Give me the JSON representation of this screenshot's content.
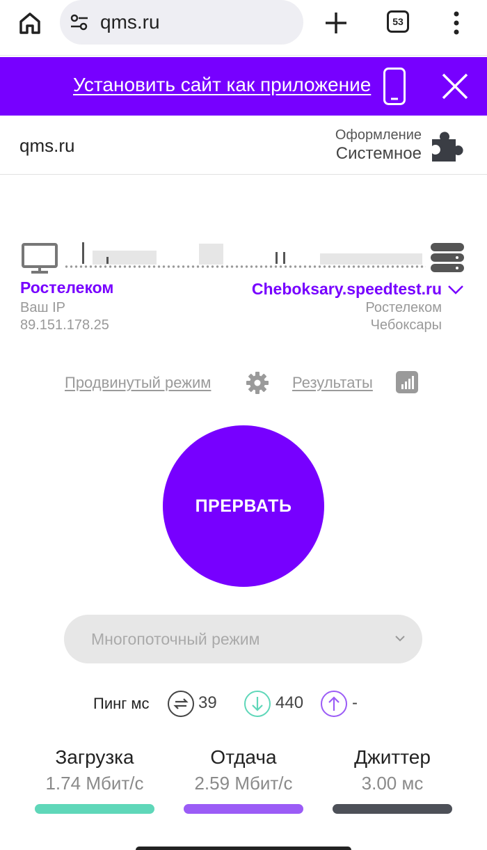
{
  "browser": {
    "url": "qms.ru",
    "tab_count": "53"
  },
  "banner": {
    "install_label": "Установить сайт как приложение"
  },
  "header": {
    "logo": "qms.ru",
    "theme_label": "Оформление",
    "theme_value": "Системное"
  },
  "client": {
    "isp": "Ростелеком",
    "ip_label": "Ваш IP",
    "ip": "89.151.178.25"
  },
  "server": {
    "host": "Cheboksary.speedtest.ru",
    "provider": "Ростелеком",
    "city": "Чебоксары"
  },
  "links": {
    "advanced": "Продвинутый режим",
    "results": "Результаты"
  },
  "abort_button": "ПРЕРВАТЬ",
  "mode_select": {
    "value": "Многопоточный режим"
  },
  "ping": {
    "label": "Пинг мс",
    "ping": "39",
    "download": "440",
    "upload": "-"
  },
  "stats": {
    "download": {
      "label": "Загрузка",
      "value": "1.74",
      "unit": "Мбит/с",
      "color": "#5fd7b9"
    },
    "upload": {
      "label": "Отдача",
      "value": "2.59",
      "unit": "Мбит/с",
      "color": "#9b5cf6"
    },
    "jitter": {
      "label": "Джиттер",
      "value": "3.00",
      "unit": "мс",
      "color": "#4d5058"
    }
  },
  "colors": {
    "accent": "#7700ff",
    "muted": "#9a9a9a"
  }
}
